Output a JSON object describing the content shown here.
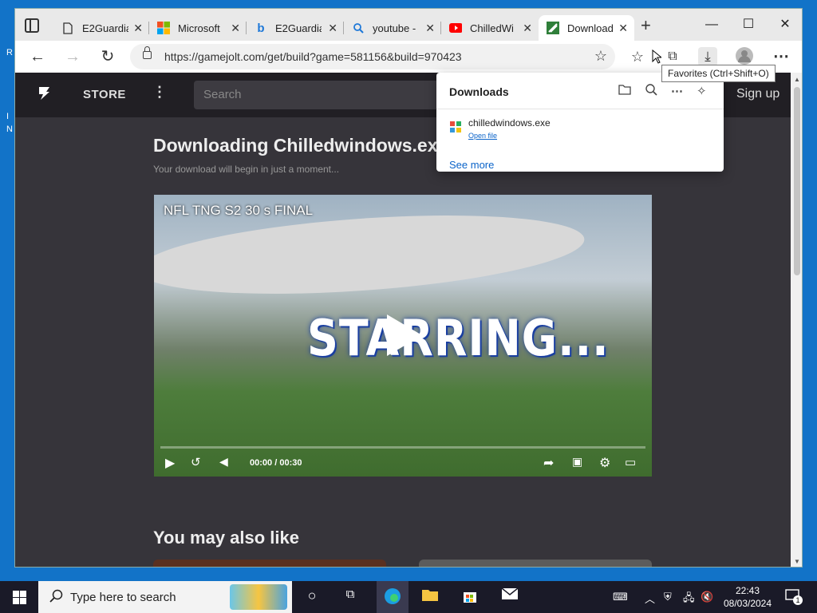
{
  "desktop": {
    "frag1": "R",
    "frag2": "I",
    "frag3": "N"
  },
  "tabs": [
    {
      "label": "E2Guardia",
      "icon": "page-icon"
    },
    {
      "label": "Microsoft",
      "icon": "microsoft-logo-icon"
    },
    {
      "label": "E2Guardia",
      "icon": "bing-icon"
    },
    {
      "label": "youtube -",
      "icon": "search-icon"
    },
    {
      "label": "ChilledWi",
      "icon": "youtube-icon"
    },
    {
      "label": "Download",
      "icon": "gamejolt-icon",
      "active": true
    }
  ],
  "toolbar": {
    "url": "https://gamejolt.com/get/build?game=581156&build=970423"
  },
  "tooltip": "Favorites (Ctrl+Shift+O)",
  "downloads": {
    "title": "Downloads",
    "file_name": "chilledwindows.exe",
    "open_file": "Open file",
    "see_more": "See more"
  },
  "gamejolt": {
    "store": "STORE",
    "search_placeholder": "Search",
    "signup": "Sign up",
    "download_title": "Downloading Chilledwindows.exe",
    "download_sub": "Your download will begin in just a moment...",
    "video_title": "NFL TNG S2 30 s FINAL",
    "video_overlay": "STARRING...",
    "video_time_current": "00:00",
    "video_time_sep": "/",
    "video_time_total": "00:30",
    "may_also_like": "You may also like"
  },
  "taskbar": {
    "search_placeholder": "Type here to search",
    "time": "22:43",
    "date": "08/03/2024",
    "notification_count": "1"
  }
}
